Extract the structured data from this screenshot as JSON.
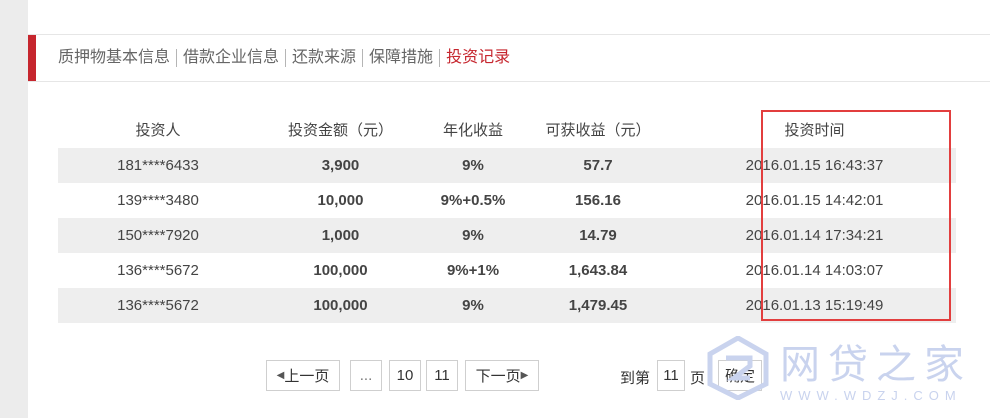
{
  "tabs": [
    "质押物基本信息",
    "借款企业信息",
    "还款来源",
    "保障措施",
    "投资记录"
  ],
  "active_tab": "投资记录",
  "table": {
    "headers": [
      "投资人",
      "投资金额（元）",
      "年化收益",
      "可获收益（元）",
      "投资时间"
    ],
    "rows": [
      {
        "investor": "181****6433",
        "amount": "3,900",
        "rate": "9%",
        "earnings": "57.7",
        "time": "2016.01.15 16:43:37"
      },
      {
        "investor": "139****3480",
        "amount": "10,000",
        "rate": "9%+0.5%",
        "earnings": "156.16",
        "time": "2016.01.15 14:42:01"
      },
      {
        "investor": "150****7920",
        "amount": "1,000",
        "rate": "9%",
        "earnings": "14.79",
        "time": "2016.01.14 17:34:21"
      },
      {
        "investor": "136****5672",
        "amount": "100,000",
        "rate": "9%+1%",
        "earnings": "1,643.84",
        "time": "2016.01.14 14:03:07"
      },
      {
        "investor": "136****5672",
        "amount": "100,000",
        "rate": "9%",
        "earnings": "1,479.45",
        "time": "2016.01.13 15:19:49"
      }
    ]
  },
  "pagination": {
    "prev_label": "上一页",
    "ellipsis": "...",
    "pages": [
      "10",
      "11"
    ],
    "next_label": "下一页",
    "goto_prefix": "到第",
    "goto_value": "11",
    "goto_suffix": "页",
    "confirm_label": "确定"
  },
  "watermark": {
    "text": "网贷之家",
    "url": "WWW.WDZJ.COM"
  },
  "colors": {
    "accent": "#c6262e",
    "highlight_box": "#e23e3e",
    "watermark": "#c9d3ee"
  }
}
